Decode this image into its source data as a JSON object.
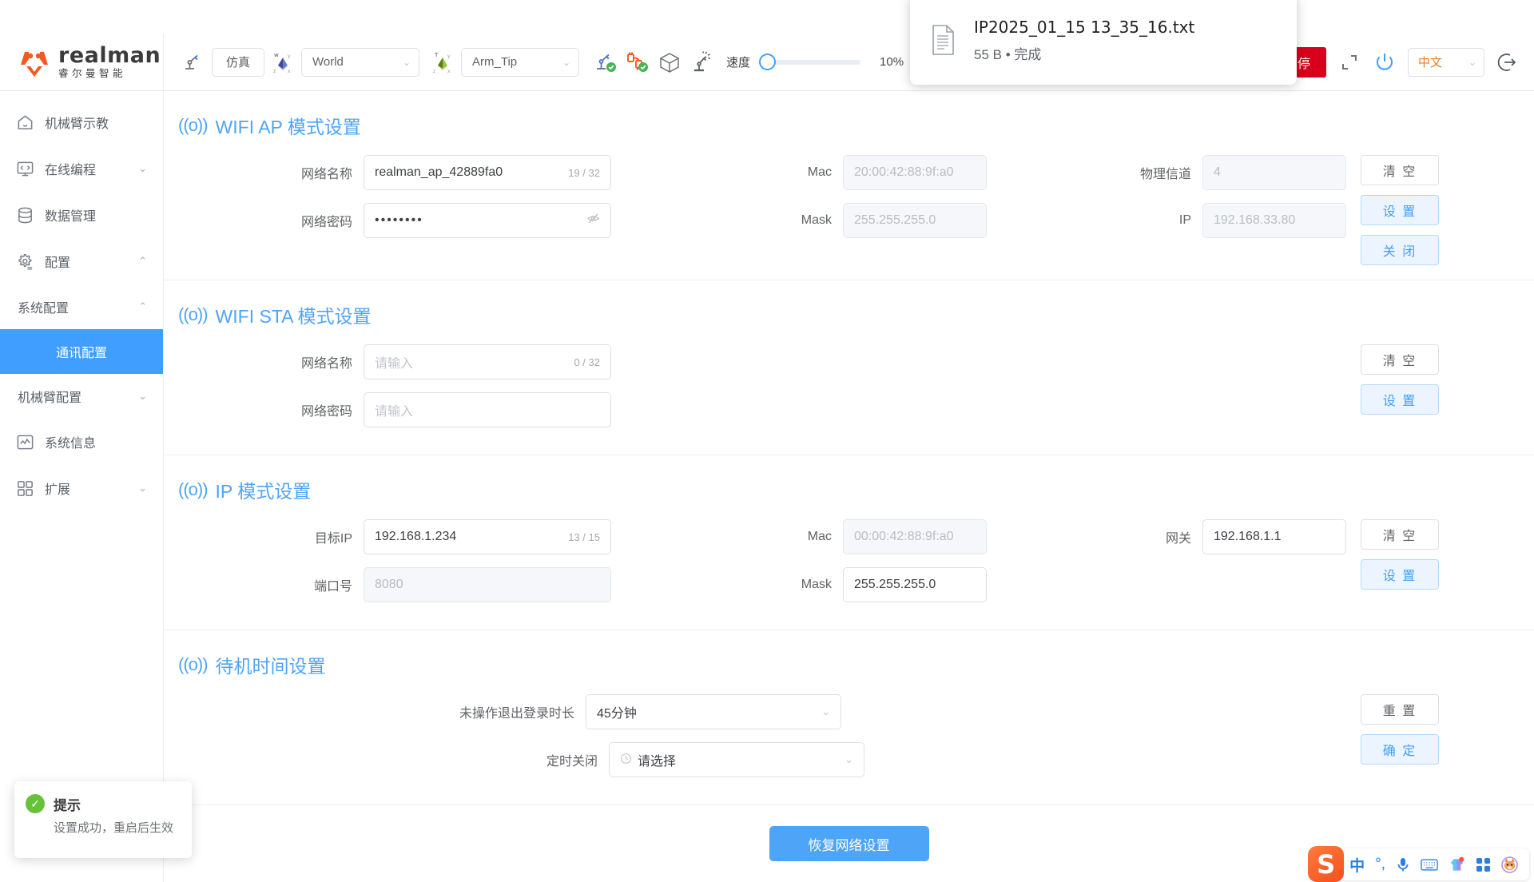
{
  "brand": {
    "name": "realman",
    "sub": "睿尔曼智能",
    "mark_icon": "realman-logo-icon"
  },
  "toolbar": {
    "robot_icon": "robot-arm-icon",
    "mode_button": "仿真",
    "frame_icon": "world-axis-icon",
    "frame_value": "World",
    "tip_icon": "tool-axis-icon",
    "tip_value": "Arm_Tip",
    "arm_status_icon": "robot-arm-check-icon",
    "cable_status_icon": "cable-check-icon",
    "cube_icon": "cube-icon",
    "collision_icon": "collision-icon",
    "speed_label": "速度",
    "speed_percent": "10%",
    "speed_value": 10,
    "stop_button": "停",
    "fullscreen_icon": "expand-icon",
    "power_icon": "power-icon",
    "language": "中文",
    "logout_icon": "logout-icon"
  },
  "sidebar": {
    "items": [
      {
        "label": "机械臂示教",
        "icon": "home-icon",
        "chevron": "",
        "name": "teach"
      },
      {
        "label": "在线编程",
        "icon": "code-monitor-icon",
        "chevron": "⌄",
        "name": "online-programming"
      },
      {
        "label": "数据管理",
        "icon": "database-icon",
        "chevron": "",
        "name": "data-management"
      },
      {
        "label": "配置",
        "icon": "gear-icon",
        "chevron": "⌃",
        "name": "configuration"
      }
    ],
    "sub_items": [
      {
        "label": "系统配置",
        "chevron": "⌃",
        "name": "system-config"
      }
    ],
    "leaf_items": [
      {
        "label": "通讯配置",
        "active": true,
        "name": "communication-config"
      }
    ],
    "sub_items_2": [
      {
        "label": "机械臂配置",
        "chevron": "⌄",
        "name": "arm-config"
      }
    ],
    "tail_items": [
      {
        "label": "系统信息",
        "icon": "chart-info-icon",
        "chevron": "",
        "name": "system-info"
      },
      {
        "label": "扩展",
        "icon": "grid-blocks-icon",
        "chevron": "⌄",
        "name": "extensions"
      }
    ]
  },
  "sections": {
    "wifi_ap": {
      "title": "WIFI AP 模式设置",
      "icon": "wifi-signal-icon",
      "fields": {
        "ssid_label": "网络名称",
        "ssid_value": "realman_ap_42889fa0",
        "ssid_count": "19 / 32",
        "pwd_label": "网络密码",
        "pwd_value": "••••••••",
        "pwd_eye_icon": "eye-off-icon",
        "mac_label": "Mac",
        "mac_value": "20:00:42:88:9f:a0",
        "mask_label": "Mask",
        "mask_value": "255.255.255.0",
        "channel_label": "物理信道",
        "channel_value": "4",
        "ip_label": "IP",
        "ip_value": "192.168.33.80"
      },
      "buttons": [
        {
          "label": "清 空",
          "style": "plain",
          "name": "clear"
        },
        {
          "label": "设 置",
          "style": "ghost",
          "name": "set"
        },
        {
          "label": "关 闭",
          "style": "ghost",
          "name": "close"
        }
      ]
    },
    "wifi_sta": {
      "title": "WIFI STA 模式设置",
      "icon": "wifi-signal-icon",
      "fields": {
        "ssid_label": "网络名称",
        "ssid_placeholder": "请输入",
        "ssid_count": "0 / 32",
        "pwd_label": "网络密码",
        "pwd_placeholder": "请输入"
      },
      "buttons": [
        {
          "label": "清 空",
          "style": "plain",
          "name": "clear"
        },
        {
          "label": "设 置",
          "style": "ghost",
          "name": "set"
        }
      ]
    },
    "ip_mode": {
      "title": "IP 模式设置",
      "icon": "wifi-signal-icon",
      "fields": {
        "target_ip_label": "目标IP",
        "target_ip_value": "192.168.1.234",
        "target_ip_count": "13 / 15",
        "port_label": "端口号",
        "port_value": "8080",
        "mac_label": "Mac",
        "mac_value": "00:00:42:88:9f:a0",
        "mask_label": "Mask",
        "mask_value": "255.255.255.0",
        "gateway_label": "网关",
        "gateway_value": "192.168.1.1"
      },
      "buttons": [
        {
          "label": "清 空",
          "style": "plain",
          "name": "clear"
        },
        {
          "label": "设 置",
          "style": "ghost",
          "name": "set"
        }
      ]
    },
    "standby": {
      "title": "待机时间设置",
      "icon": "wifi-signal-icon",
      "fields": {
        "logout_label": "未操作退出登录时长",
        "logout_value": "45分钟",
        "shutdown_label": "定时关闭",
        "shutdown_placeholder": "请选择",
        "clock_icon": "clock-icon"
      },
      "buttons": [
        {
          "label": "重 置",
          "style": "plain",
          "name": "reset"
        },
        {
          "label": "确 定",
          "style": "ghost",
          "name": "confirm"
        }
      ]
    },
    "restore_button": "恢复网络设置"
  },
  "download_popup": {
    "file_icon": "text-file-icon",
    "filename": "IP2025_01_15 13_35_16.txt",
    "meta": "55 B • 完成"
  },
  "toast": {
    "icon": "success-check-icon",
    "title": "提示",
    "message": "设置成功，重启后生效"
  },
  "ime": {
    "logo": "S",
    "items": [
      {
        "icon": "chinese-mode-icon",
        "glyph": "中"
      },
      {
        "icon": "punctuation-icon",
        "glyph": "°,"
      },
      {
        "icon": "microphone-icon",
        "glyph": "🎤"
      },
      {
        "icon": "keyboard-icon",
        "glyph": "⌨"
      },
      {
        "icon": "skin-icon",
        "glyph": ""
      },
      {
        "icon": "apps-grid-icon",
        "glyph": ""
      },
      {
        "icon": "mascot-icon",
        "glyph": ""
      }
    ]
  },
  "colors": {
    "accent": "#4ea4f7",
    "brand_orange": "#f15a22",
    "danger": "#d9001b",
    "success": "#67c23a"
  }
}
